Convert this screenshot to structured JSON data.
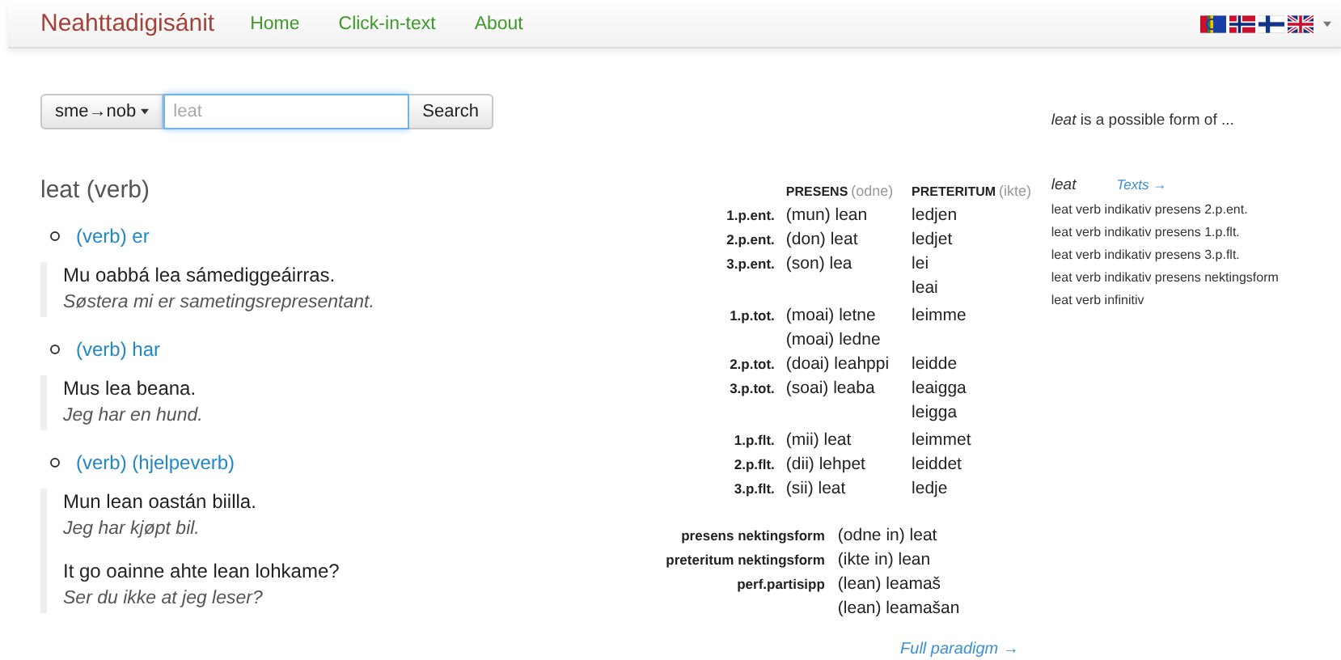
{
  "navbar": {
    "brand": "Neahttadigisánit",
    "links": [
      {
        "label": "Home"
      },
      {
        "label": "Click-in-text"
      },
      {
        "label": "About"
      }
    ]
  },
  "search": {
    "language_pair": "sme→nob",
    "placeholder": "leat",
    "button": "Search"
  },
  "entry": {
    "title": "leat (verb)",
    "senses": [
      {
        "label": "(verb) er",
        "examples": [
          {
            "source": "Mu oabbá lea sámediggeáirras.",
            "translation": "Søstera mi er sametingsrepresentant."
          }
        ]
      },
      {
        "label": "(verb) har",
        "examples": [
          {
            "source": "Mus lea beana.",
            "translation": "Jeg har en hund."
          }
        ]
      },
      {
        "label": "(verb) (hjelpeverb)",
        "examples": [
          {
            "source": "Mun lean oastán biilla.",
            "translation": "Jeg har kjøpt bil."
          },
          {
            "source": "It go oainne ahte lean lohkame?",
            "translation": "Ser du ikke at jeg leser?"
          }
        ]
      }
    ]
  },
  "paradigm": {
    "columns": [
      {
        "name": "PRESENS",
        "note": "(odne)"
      },
      {
        "name": "PRETERITUM",
        "note": "(ikte)"
      }
    ],
    "groups": [
      [
        {
          "label": "1.p.ent.",
          "cells": [
            [
              "(mun) lean"
            ],
            [
              "ledjen"
            ]
          ]
        },
        {
          "label": "2.p.ent.",
          "cells": [
            [
              "(don) leat"
            ],
            [
              "ledjet"
            ]
          ]
        },
        {
          "label": "3.p.ent.",
          "cells": [
            [
              "(son) lea"
            ],
            [
              "lei",
              "leai"
            ]
          ]
        }
      ],
      [
        {
          "label": "1.p.tot.",
          "cells": [
            [
              "(moai) letne",
              "(moai) ledne"
            ],
            [
              "leimme"
            ]
          ]
        },
        {
          "label": "2.p.tot.",
          "cells": [
            [
              "(doai) leahppi"
            ],
            [
              "leidde"
            ]
          ]
        },
        {
          "label": "3.p.tot.",
          "cells": [
            [
              "(soai) leaba"
            ],
            [
              "leaigga",
              "leigga"
            ]
          ]
        }
      ],
      [
        {
          "label": "1.p.flt.",
          "cells": [
            [
              "(mii) leat"
            ],
            [
              "leimmet"
            ]
          ]
        },
        {
          "label": "2.p.flt.",
          "cells": [
            [
              "(dii) lehpet"
            ],
            [
              "leiddet"
            ]
          ]
        },
        {
          "label": "3.p.flt.",
          "cells": [
            [
              "(sii) leat"
            ],
            [
              "ledje"
            ]
          ]
        }
      ]
    ],
    "nonfinite": [
      {
        "label": "presens nektingsform",
        "values": [
          "(odne in) leat"
        ]
      },
      {
        "label": "preteritum nektingsform",
        "values": [
          "(ikte in) lean"
        ]
      },
      {
        "label": "perf.partisipp",
        "values": [
          "(lean) leamaš",
          "(lean) leamašan"
        ]
      }
    ],
    "full_link": "Full paradigm →"
  },
  "analyses": {
    "intro": "*leat* is a possible form of ...",
    "lemma": "leat",
    "texts_link": "Texts →",
    "items": [
      "leat verb indikativ presens 2.p.ent.",
      "leat verb indikativ presens 1.p.flt.",
      "leat verb indikativ presens 3.p.flt.",
      "leat verb indikativ presens nektingsform",
      "leat verb infinitiv"
    ]
  }
}
